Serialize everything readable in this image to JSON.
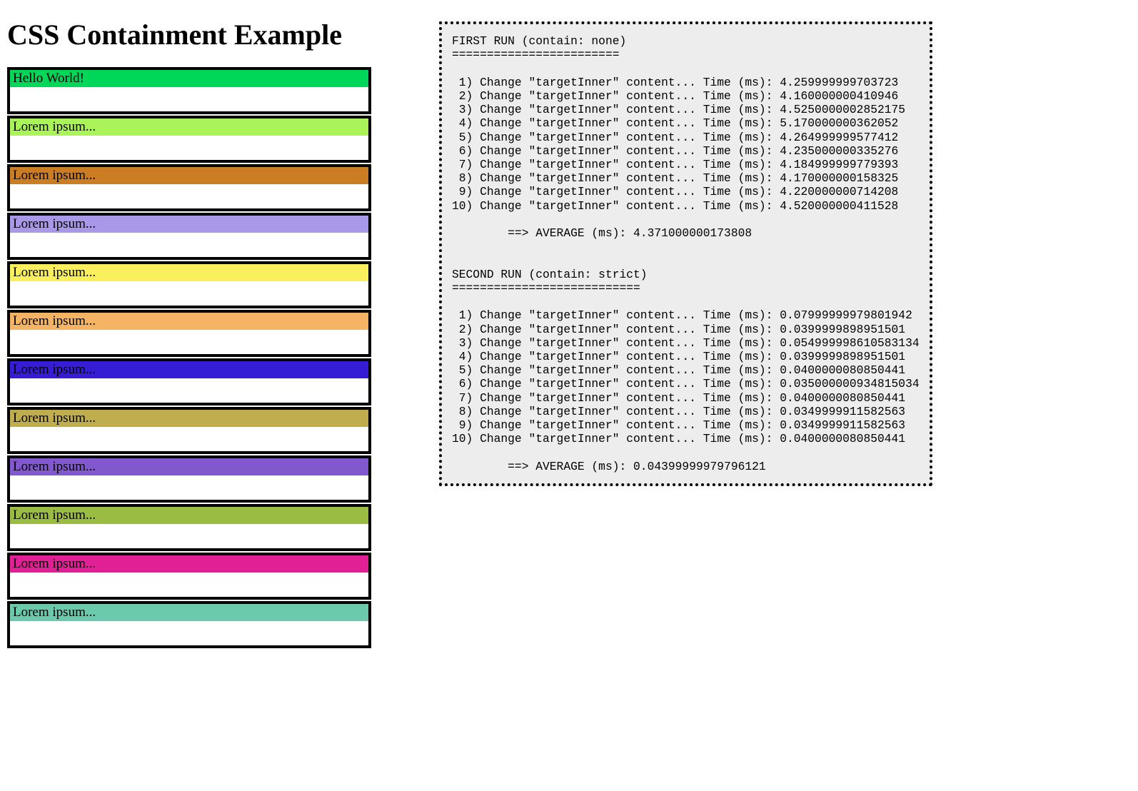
{
  "title": "CSS Containment Example",
  "cards": [
    {
      "label": "Hello World!",
      "color": "#00D657"
    },
    {
      "label": "Lorem ipsum...",
      "color": "#AAF459"
    },
    {
      "label": "Lorem ipsum...",
      "color": "#CB7D24"
    },
    {
      "label": "Lorem ipsum...",
      "color": "#A997E8"
    },
    {
      "label": "Lorem ipsum...",
      "color": "#FAEF5D"
    },
    {
      "label": "Lorem ipsum...",
      "color": "#F5B464"
    },
    {
      "label": "Lorem ipsum...",
      "color": "#341DD5"
    },
    {
      "label": "Lorem ipsum...",
      "color": "#C0AE4E"
    },
    {
      "label": "Lorem ipsum...",
      "color": "#8258CF"
    },
    {
      "label": "Lorem ipsum...",
      "color": "#9BBC42"
    },
    {
      "label": "Lorem ipsum...",
      "color": "#E22095"
    },
    {
      "label": "Lorem ipsum...",
      "color": "#6BC9AC"
    }
  ],
  "log": {
    "run1_header": "FIRST RUN (contain: none)",
    "run1_underline": "========================",
    "run1_lines": [
      " 1) Change \"targetInner\" content... Time (ms): 4.259999999703723",
      " 2) Change \"targetInner\" content... Time (ms): 4.160000000410946",
      " 3) Change \"targetInner\" content... Time (ms): 4.5250000002852175",
      " 4) Change \"targetInner\" content... Time (ms): 5.170000000362052",
      " 5) Change \"targetInner\" content... Time (ms): 4.264999999577412",
      " 6) Change \"targetInner\" content... Time (ms): 4.235000000335276",
      " 7) Change \"targetInner\" content... Time (ms): 4.184999999779393",
      " 8) Change \"targetInner\" content... Time (ms): 4.170000000158325",
      " 9) Change \"targetInner\" content... Time (ms): 4.220000000714208",
      "10) Change \"targetInner\" content... Time (ms): 4.520000000411528"
    ],
    "run1_avg": "        ==> AVERAGE (ms): 4.371000000173808",
    "run2_header": "SECOND RUN (contain: strict)",
    "run2_underline": "===========================",
    "run2_lines": [
      " 1) Change \"targetInner\" content... Time (ms): 0.07999999979801942",
      " 2) Change \"targetInner\" content... Time (ms): 0.0399999898951501",
      " 3) Change \"targetInner\" content... Time (ms): 0.054999998610583134",
      " 4) Change \"targetInner\" content... Time (ms): 0.0399999898951501",
      " 5) Change \"targetInner\" content... Time (ms): 0.0400000080850441",
      " 6) Change \"targetInner\" content... Time (ms): 0.035000000934815034",
      " 7) Change \"targetInner\" content... Time (ms): 0.0400000080850441",
      " 8) Change \"targetInner\" content... Time (ms): 0.0349999911582563",
      " 9) Change \"targetInner\" content... Time (ms): 0.0349999911582563",
      "10) Change \"targetInner\" content... Time (ms): 0.0400000080850441"
    ],
    "run2_avg": "        ==> AVERAGE (ms): 0.04399999979796121"
  }
}
